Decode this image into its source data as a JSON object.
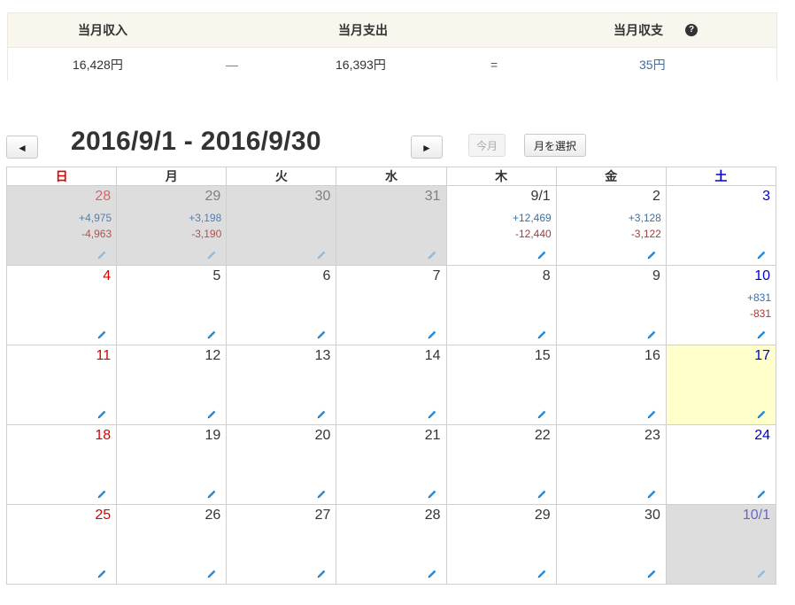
{
  "summary": {
    "income_label": "当月収入",
    "expense_label": "当月支出",
    "balance_label": "当月収支",
    "help_glyph": "?",
    "income_value": "16,428円",
    "minus_sign": "—",
    "expense_value": "16,393円",
    "equals_sign": "=",
    "balance_value": "35円"
  },
  "nav": {
    "prev_label": "◄",
    "title": "2016/9/1 - 2016/9/30",
    "next_label": "►",
    "today_label": "今月",
    "select_month_label": "月を選択"
  },
  "calendar": {
    "weekdays": [
      "日",
      "月",
      "火",
      "水",
      "木",
      "金",
      "土"
    ],
    "weekday_colors": [
      "#dd0000",
      "#333333",
      "#333333",
      "#333333",
      "#333333",
      "#333333",
      "#0000cc"
    ],
    "weeks": [
      [
        {
          "day": "28",
          "income": "+4,975",
          "expense": "-4,963",
          "other": true
        },
        {
          "day": "29",
          "income": "+3,198",
          "expense": "-3,190",
          "other": true
        },
        {
          "day": "30",
          "income": "",
          "expense": "",
          "other": true
        },
        {
          "day": "31",
          "income": "",
          "expense": "",
          "other": true
        },
        {
          "day": "9/1",
          "income": "+12,469",
          "expense": "-12,440",
          "other": false
        },
        {
          "day": "2",
          "income": "+3,128",
          "expense": "-3,122",
          "other": false
        },
        {
          "day": "3",
          "income": "",
          "expense": "",
          "other": false
        }
      ],
      [
        {
          "day": "4",
          "income": "",
          "expense": "",
          "other": false
        },
        {
          "day": "5",
          "income": "",
          "expense": "",
          "other": false
        },
        {
          "day": "6",
          "income": "",
          "expense": "",
          "other": false
        },
        {
          "day": "7",
          "income": "",
          "expense": "",
          "other": false
        },
        {
          "day": "8",
          "income": "",
          "expense": "",
          "other": false
        },
        {
          "day": "9",
          "income": "",
          "expense": "",
          "other": false
        },
        {
          "day": "10",
          "income": "+831",
          "expense": "-831",
          "other": false
        }
      ],
      [
        {
          "day": "11",
          "income": "",
          "expense": "",
          "other": false
        },
        {
          "day": "12",
          "income": "",
          "expense": "",
          "other": false
        },
        {
          "day": "13",
          "income": "",
          "expense": "",
          "other": false
        },
        {
          "day": "14",
          "income": "",
          "expense": "",
          "other": false
        },
        {
          "day": "15",
          "income": "",
          "expense": "",
          "other": false
        },
        {
          "day": "16",
          "income": "",
          "expense": "",
          "other": false
        },
        {
          "day": "17",
          "income": "",
          "expense": "",
          "other": false,
          "today": true
        }
      ],
      [
        {
          "day": "18",
          "income": "",
          "expense": "",
          "other": false
        },
        {
          "day": "19",
          "income": "",
          "expense": "",
          "other": false
        },
        {
          "day": "20",
          "income": "",
          "expense": "",
          "other": false
        },
        {
          "day": "21",
          "income": "",
          "expense": "",
          "other": false
        },
        {
          "day": "22",
          "income": "",
          "expense": "",
          "other": false
        },
        {
          "day": "23",
          "income": "",
          "expense": "",
          "other": false
        },
        {
          "day": "24",
          "income": "",
          "expense": "",
          "other": false
        }
      ],
      [
        {
          "day": "25",
          "income": "",
          "expense": "",
          "other": false
        },
        {
          "day": "26",
          "income": "",
          "expense": "",
          "other": false
        },
        {
          "day": "27",
          "income": "",
          "expense": "",
          "other": false
        },
        {
          "day": "28",
          "income": "",
          "expense": "",
          "other": false
        },
        {
          "day": "29",
          "income": "",
          "expense": "",
          "other": false
        },
        {
          "day": "30",
          "income": "",
          "expense": "",
          "other": false
        },
        {
          "day": "10/1",
          "income": "",
          "expense": "",
          "other": true
        }
      ]
    ],
    "edit_icon": "pencil-icon",
    "edit_icon_color": "#2a8ad4"
  }
}
